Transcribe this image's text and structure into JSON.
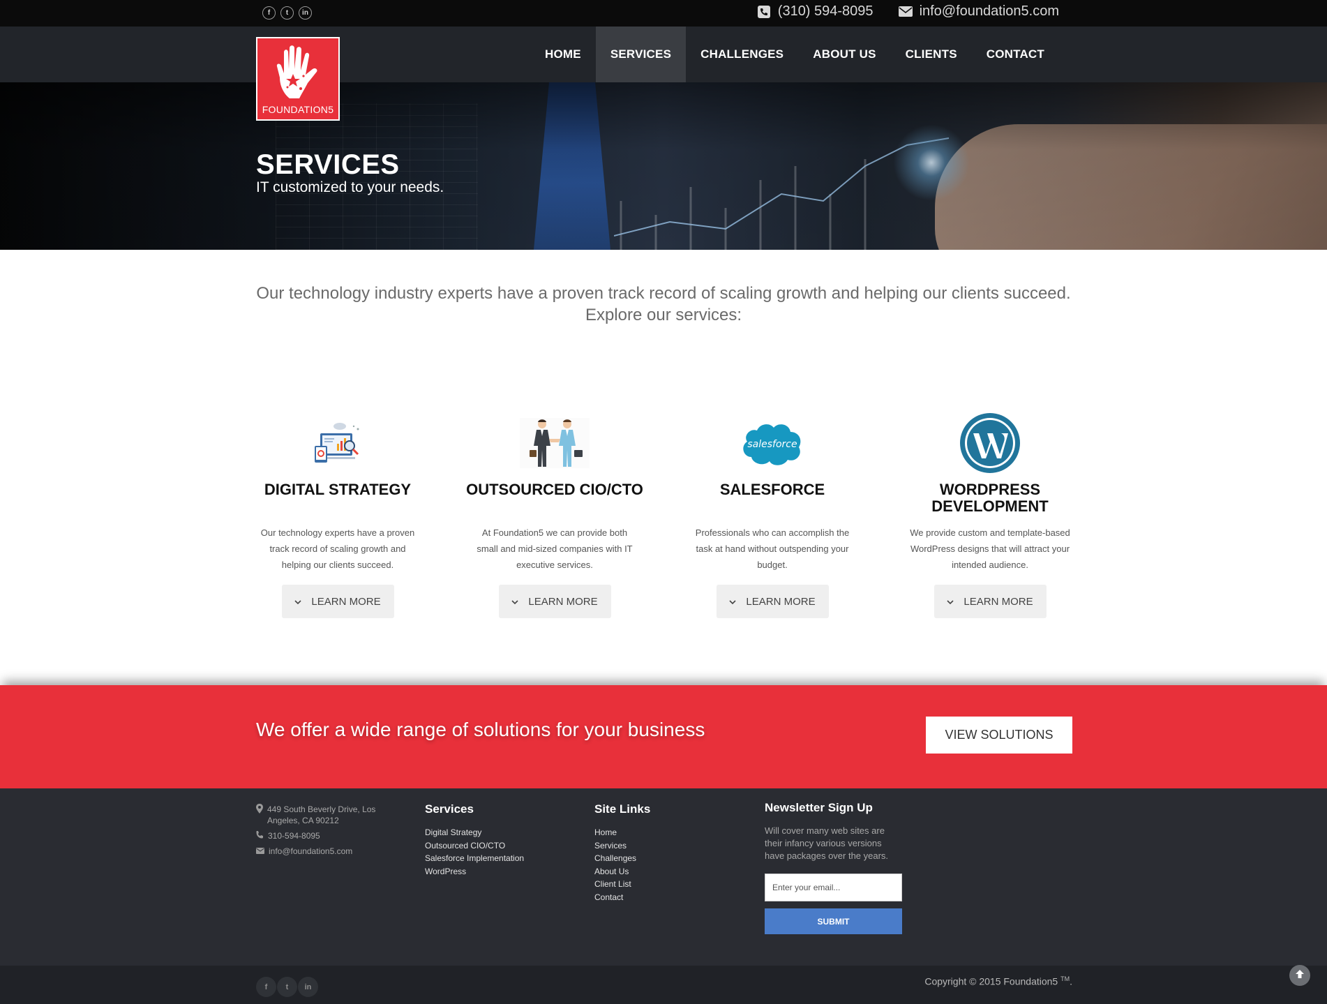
{
  "topbar": {
    "phone": "(310) 594-8095",
    "email": "info@foundation5.com",
    "social": [
      "f",
      "t",
      "in"
    ],
    "icons": {
      "phone": "phone-icon",
      "email": "envelope-icon"
    }
  },
  "logo": {
    "brand": "FOUNDATION5"
  },
  "nav": {
    "items": [
      {
        "label": "HOME"
      },
      {
        "label": "SERVICES"
      },
      {
        "label": "CHALLENGES"
      },
      {
        "label": "ABOUT US"
      },
      {
        "label": "CLIENTS"
      },
      {
        "label": "CONTACT"
      }
    ],
    "active": "SERVICES"
  },
  "hero": {
    "title": "SERVICES",
    "subtitle": "IT customized to your needs."
  },
  "intro": {
    "line1": "Our technology industry experts have a proven track record of scaling growth and helping our clients succeed.",
    "line2": "Explore our services:"
  },
  "services": [
    {
      "title": "DIGITAL STRATEGY",
      "text": "Our technology experts have a proven track record of scaling growth and helping our clients succeed.",
      "button": "LEARN MORE",
      "icon": "digital-strategy-icon"
    },
    {
      "title": "OUTSOURCED CIO/CTO",
      "text": "At Foundation5 we can provide both small and mid-sized companies with IT executive services.",
      "button": "LEARN MORE",
      "icon": "handshake-icon"
    },
    {
      "title": "SALESFORCE",
      "text": "Professionals who can accomplish the task at hand without outspending your budget.",
      "button": "LEARN MORE",
      "icon": "salesforce-logo-icon",
      "logo_text": "salesforce"
    },
    {
      "title": "WORDPRESS DEVELOPMENT",
      "text": "We provide custom and template-based WordPress designs that will attract your intended audience.",
      "button": "LEARN MORE",
      "icon": "wordpress-logo-icon"
    }
  ],
  "cta": {
    "message": "We offer a wide range of solutions for your business",
    "button": "VIEW SOLUTIONS"
  },
  "footer": {
    "address": "449 South Beverly Drive, Los Angeles, CA 90212",
    "phone": "310-594-8095",
    "email": "info@foundation5.com",
    "services_title": "Services",
    "services_links": [
      "Digital Strategy",
      "Outsourced CIO/CTO",
      "Salesforce Implementation",
      "WordPress"
    ],
    "site_title": "Site Links",
    "site_links": [
      "Home",
      "Services",
      "Challenges",
      "About Us",
      "Client List",
      "Contact"
    ],
    "newsletter_title": "Newsletter Sign Up",
    "newsletter_text": "Will cover many web sites are their infancy various versions have packages over the years.",
    "email_placeholder": "Enter your email...",
    "submit": "SUBMIT"
  },
  "bottom": {
    "copyright": "Copyright © 2015 Foundation5 ",
    "tm": "TM",
    "period": ".",
    "social": [
      "f",
      "t",
      "in"
    ]
  },
  "colors": {
    "brand_red": "#e8303a",
    "nav_bg": "#22252a",
    "footer_bg": "#2a2c32",
    "submit_blue": "#4a7cc9"
  }
}
